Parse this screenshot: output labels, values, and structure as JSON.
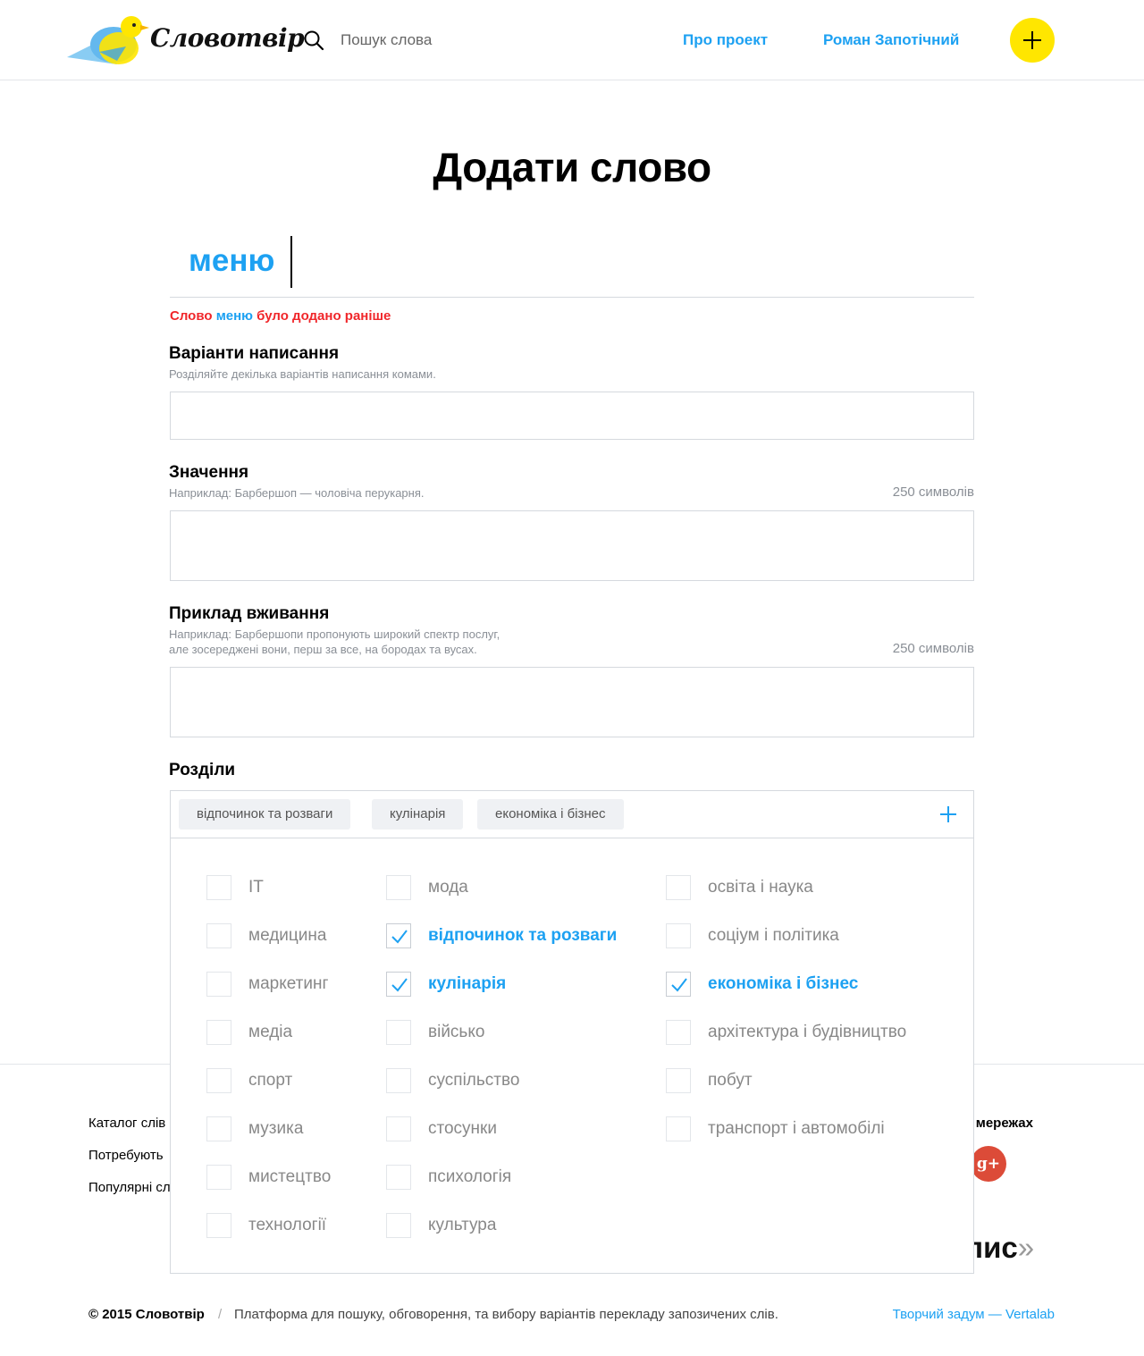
{
  "header": {
    "logo_text": "Словотвір",
    "search_placeholder": "Пошук слова",
    "nav": {
      "about": "Про проект",
      "user": "Роман Запотічний"
    },
    "add_icon": "plus-icon",
    "search_icon": "search-icon"
  },
  "page": {
    "title": "Додати слово"
  },
  "word": {
    "value": "меню",
    "warning_prefix": "Слово",
    "warning_word": "меню",
    "warning_suffix": "було додано раніше"
  },
  "spellings": {
    "label": "Варіанти написання",
    "hint": "Розділяйте декілька варіантів написання комами.",
    "value": ""
  },
  "meaning": {
    "label": "Значення",
    "hint": "Наприклад: Барбершоп — чоловіча перукарня.",
    "counter": "250 символів",
    "value": ""
  },
  "example": {
    "label": "Приклад вживання",
    "hint_line1": "Наприклад: Барбершопи пропонують широкий спектр послуг,",
    "hint_line2": "але зосереджені вони, перш за все, на бородах та вусах.",
    "counter": "250 символів",
    "value": ""
  },
  "sections": {
    "label": "Розділи",
    "selected": [
      "відпочинок та розваги",
      "кулінарія",
      "економіка і бізнес"
    ],
    "columns": [
      [
        {
          "label": "IT",
          "checked": false
        },
        {
          "label": "медицина",
          "checked": false
        },
        {
          "label": "маркетинг",
          "checked": false
        },
        {
          "label": "медіа",
          "checked": false
        },
        {
          "label": "спорт",
          "checked": false
        },
        {
          "label": "музика",
          "checked": false
        },
        {
          "label": "мистецтво",
          "checked": false
        },
        {
          "label": "технології",
          "checked": false
        }
      ],
      [
        {
          "label": "мода",
          "checked": false
        },
        {
          "label": "відпочинок та розваги",
          "checked": true
        },
        {
          "label": "кулінарія",
          "checked": true
        },
        {
          "label": "військо",
          "checked": false
        },
        {
          "label": "суспільство",
          "checked": false
        },
        {
          "label": "стосунки",
          "checked": false
        },
        {
          "label": "психологія",
          "checked": false
        },
        {
          "label": "культура",
          "checked": false
        }
      ],
      [
        {
          "label": "освіта і наука",
          "checked": false
        },
        {
          "label": "соціум і політика",
          "checked": false
        },
        {
          "label": "економіка і бізнес",
          "checked": true
        },
        {
          "label": "архітектура і будівництво",
          "checked": false
        },
        {
          "label": "побут",
          "checked": false
        },
        {
          "label": "транспорт і автомобілі",
          "checked": false
        }
      ]
    ]
  },
  "footer": {
    "links": [
      "Каталог слів",
      "Потребують",
      "Популярні сл"
    ],
    "social_label": "их мережах",
    "social_icon": "google-plus-icon",
    "partner_text": "опис",
    "partner_arrow": "»",
    "copyright": "© 2015 Словотвір",
    "separator": "/",
    "tagline": "Платформа для пошуку, обговорення, та вибору варіантів перекладу запозичених слів.",
    "credits": "Творчий задум — Vertalab"
  },
  "colors": {
    "accent": "#1da1f2",
    "yellow": "#ffe600",
    "error": "#f0262a",
    "gplus": "#dc4b38"
  }
}
